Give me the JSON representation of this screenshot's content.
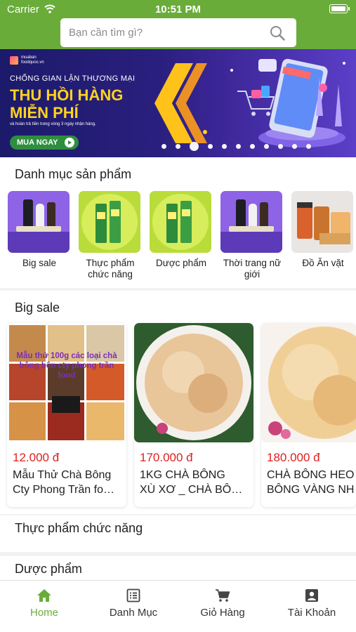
{
  "status_bar": {
    "carrier": "Carrier",
    "time": "10:51 PM"
  },
  "search": {
    "placeholder": "Bạn cần tìm gì?"
  },
  "banner": {
    "brand": "muaban foodquoc.vn",
    "kicker": "CHỐNG GIAN LẬN THƯƠNG MẠI",
    "headline_1": "THU HỒI HÀNG",
    "headline_2": "MIỄN PHÍ",
    "subtext": "và hoàn trả tiền trong vòng 3 ngày nhận hàng.",
    "cta": "MUA NGAY",
    "slide_count": 12,
    "active_slide": 3
  },
  "categories": {
    "title": "Danh mục sản phẩm",
    "items": [
      {
        "label": "Big sale"
      },
      {
        "label": "Thực phẩm chức năng"
      },
      {
        "label": "Dược phẩm"
      },
      {
        "label": "Thời trang nữ giới"
      },
      {
        "label": "Đồ Ăn vặt"
      }
    ]
  },
  "big_sale": {
    "title": "Big sale",
    "products": [
      {
        "price": "12.000 đ",
        "name_1": "Mẫu Thử Chà Bông",
        "name_2": "Cty Phong Trần fo…",
        "overlay": "Mẫu thử 100g các loại chà bông bên cty phong trần food"
      },
      {
        "price": "170.000 đ",
        "name_1": "1KG CHÀ BÔNG",
        "name_2": "XÙ XƠ _ CHÀ BÔ…"
      },
      {
        "price": "180.000 đ",
        "name_1": "CHÀ BÔNG HEO",
        "name_2": "BÔNG VÀNG NH"
      }
    ]
  },
  "sections": {
    "functional_food": "Thực phẩm chức năng",
    "pharma": "Dược phẩm"
  },
  "tabbar": {
    "accent": "#6aac3a",
    "items": [
      {
        "label": "Home",
        "icon": "home-icon"
      },
      {
        "label": "Danh Mục",
        "icon": "list-icon"
      },
      {
        "label": "Giỏ Hàng",
        "icon": "cart-icon"
      },
      {
        "label": "Tài Khoản",
        "icon": "account-icon"
      }
    ]
  }
}
